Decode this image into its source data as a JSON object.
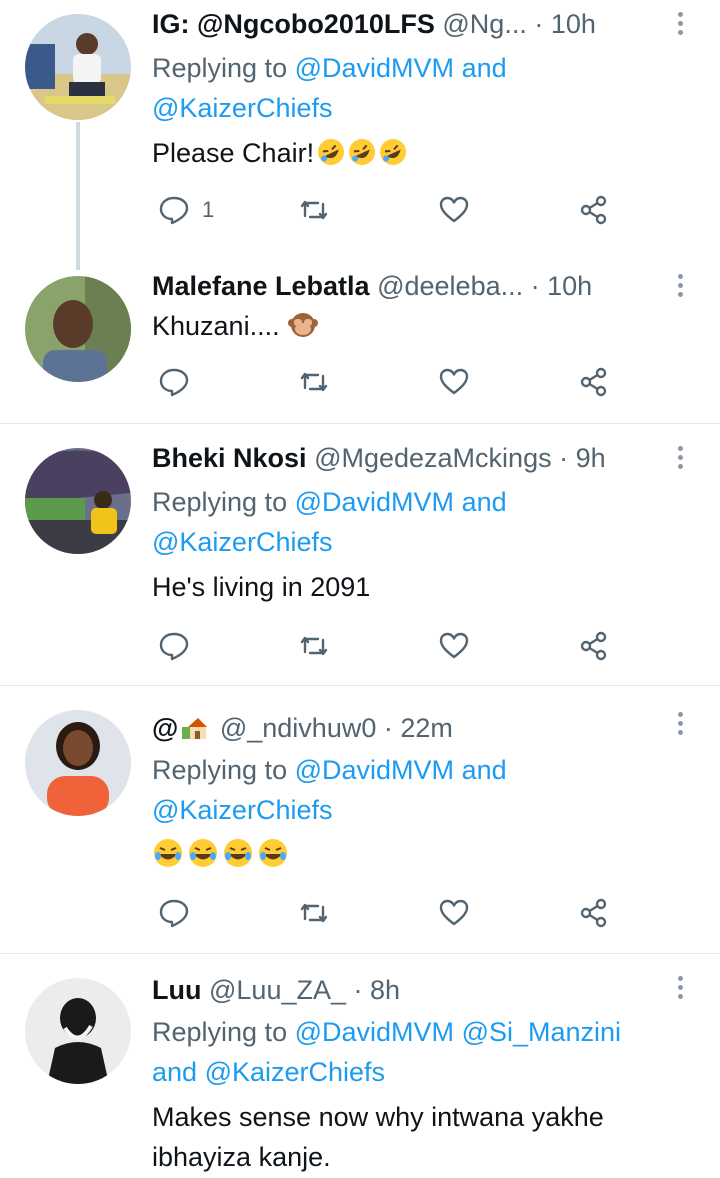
{
  "tweets": [
    {
      "name": "IG: @Ngcobo2010LFS",
      "handle": "@Ng...",
      "dot": "·",
      "time": "10h",
      "reply_prefix": "Replying to",
      "reply_line1_mention": "@DavidMVM",
      "reply_line1_and": "and",
      "reply_line2_mention": "@KaizerChiefs",
      "text": "Please Chair!",
      "emojis": [
        "rofl-emoji",
        "rofl-emoji",
        "rofl-emoji"
      ],
      "reply_count": "1"
    },
    {
      "name": "Malefane Lebatla",
      "handle": "@deeleba...",
      "dot": "·",
      "time": "10h",
      "text": "Khuzani....",
      "emojis": [
        "see-no-evil-monkey-emoji"
      ]
    },
    {
      "name": "Bheki Nkosi",
      "handle": "@MgedezaMckings",
      "dot": "·",
      "time": "9h",
      "reply_prefix": "Replying to",
      "reply_line1_mention": "@DavidMVM",
      "reply_line1_and": "and",
      "reply_line2_mention": "@KaizerChiefs",
      "text": "He's living in 2091"
    },
    {
      "name": "@",
      "handle": "@_ndivhuw0",
      "dot": "·",
      "time": "22m",
      "reply_prefix": "Replying to",
      "reply_line1_mention": "@DavidMVM",
      "reply_line1_and": "and",
      "reply_line2_mention": "@KaizerChiefs",
      "emojis": [
        "joy-emoji",
        "joy-emoji",
        "joy-emoji",
        "joy-emoji"
      ]
    },
    {
      "name": "Luu",
      "handle": "@Luu_ZA_",
      "dot": "·",
      "time": "8h",
      "reply_prefix": "Replying to",
      "reply_line1_mention": "@DavidMVM",
      "reply_line1_mention2": "@Si_Manzini",
      "reply_line2_and": "and",
      "reply_line2_mention": "@KaizerChiefs",
      "text_line1": "Makes sense now why intwana yakhe",
      "text_line2": "ibhayiza kanje."
    }
  ],
  "icons": {
    "reply": "reply-icon",
    "retweet": "retweet-icon",
    "like": "like-icon",
    "share": "share-icon",
    "more": "more-options-icon"
  },
  "colors": {
    "link": "#1d9bf0",
    "secondary_text": "#536471",
    "divider": "#e6e9ec",
    "thread_line": "#cfd9de"
  }
}
